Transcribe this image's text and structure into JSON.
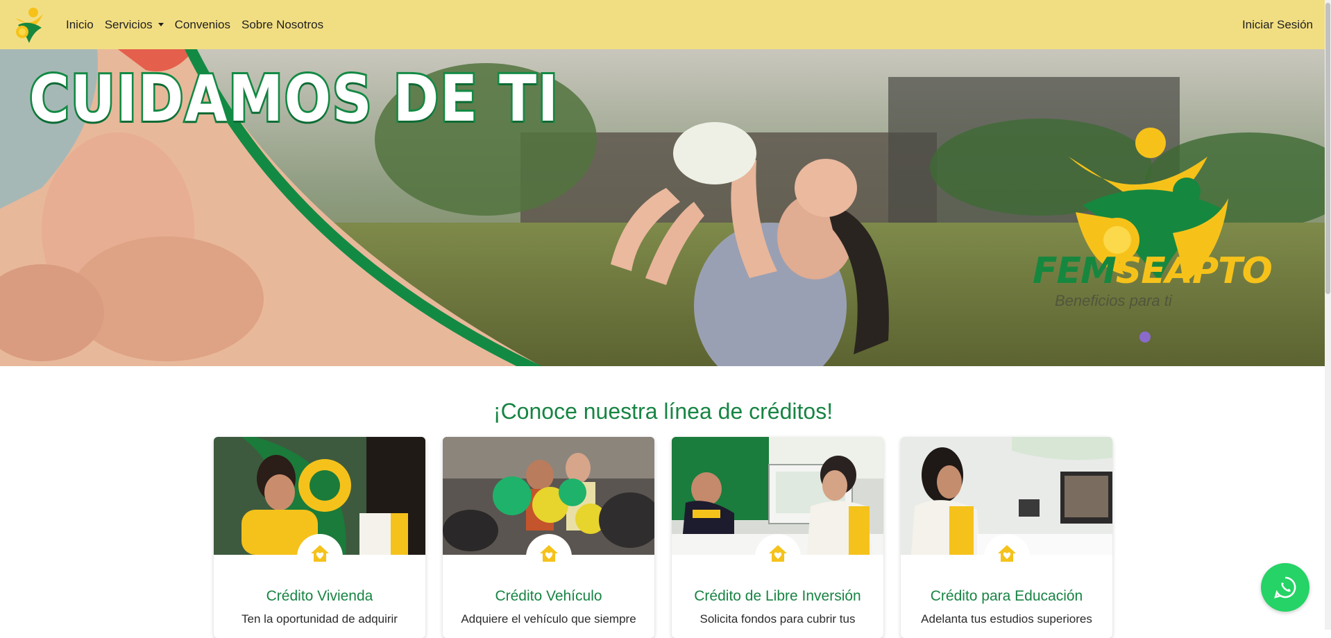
{
  "nav": {
    "logo_icon": "femseapto-logo-icon",
    "links": [
      {
        "label": "Inicio"
      },
      {
        "label": "Servicios"
      },
      {
        "label": "Convenios"
      },
      {
        "label": "Sobre Nosotros"
      }
    ],
    "login_label": "Iniciar Sesión",
    "background": "#f2de82"
  },
  "hero": {
    "title": "CUIDAMOS DE TI",
    "brand_part1": "FEM",
    "brand_part2": "SEAPTO",
    "tagline": "Beneficios para ti",
    "accent_green": "#138a44",
    "accent_yellow": "#f6c21a"
  },
  "credits": {
    "title": "¡Conoce nuestra línea de créditos!",
    "cards": [
      {
        "title": "Crédito Vivienda",
        "text": "Ten la oportunidad de adquirir",
        "icon": "house-heart-icon"
      },
      {
        "title": "Crédito Vehículo",
        "text": "Adquiere el vehículo que siempre",
        "icon": "house-heart-icon"
      },
      {
        "title": "Crédito de Libre Inversión",
        "text": "Solicita fondos para cubrir tus",
        "icon": "house-heart-icon"
      },
      {
        "title": "Crédito para Educación",
        "text": "Adelanta tus estudios superiores",
        "icon": "house-heart-icon"
      }
    ]
  },
  "whatsapp": {
    "icon": "whatsapp-icon",
    "color": "#25d366"
  }
}
